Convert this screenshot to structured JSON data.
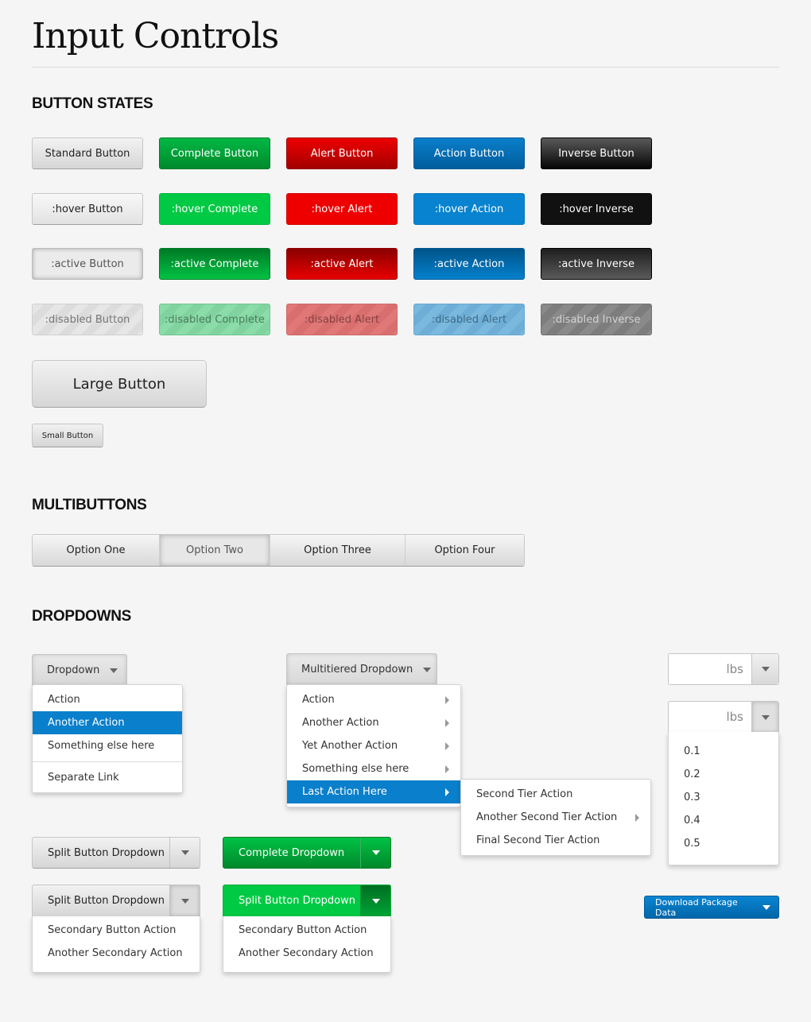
{
  "page": {
    "title": "Input Controls"
  },
  "sections": {
    "button_states": "BUTTON STATES",
    "multibuttons": "MULTIBUTTONS",
    "dropdowns": "DROPDOWNS"
  },
  "button_grid": {
    "rows": [
      {
        "state": "normal",
        "labels": [
          "Standard Button",
          "Complete Button",
          "Alert Button",
          "Action Button",
          "Inverse Button"
        ]
      },
      {
        "state": "hover",
        "labels": [
          ":hover Button",
          ":hover Complete",
          ":hover Alert",
          ":hover Action",
          ":hover Inverse"
        ]
      },
      {
        "state": "active",
        "labels": [
          ":active Button",
          ":active Complete",
          ":active Alert",
          ":active Action",
          ":active Inverse"
        ]
      },
      {
        "state": "disabled",
        "labels": [
          ":disabled Button",
          ":disabled Complete",
          ":disabled Alert",
          ":disabled Alert",
          ":disabled Inverse"
        ]
      }
    ],
    "variants": [
      "standard",
      "complete",
      "alert",
      "action",
      "inverse"
    ]
  },
  "sizes": {
    "large": "Large Button",
    "small": "Small Button"
  },
  "multibuttons": {
    "options": [
      "Option One",
      "Option Two",
      "Option Three",
      "Option Four"
    ],
    "selected": "Option Two"
  },
  "dropdown_simple": {
    "toggle": "Dropdown",
    "items": [
      "Action",
      "Another Action",
      "Something else here"
    ],
    "highlighted": "Another Action",
    "separated_items": [
      "Separate Link"
    ]
  },
  "dropdown_multitier": {
    "toggle": "Multitiered Dropdown",
    "items": [
      "Action",
      "Another Action",
      "Yet Another Action",
      "Something else here",
      "Last Action Here"
    ],
    "highlighted": "Last Action Here",
    "submenu": {
      "items": [
        "Second Tier Action",
        "Another Second Tier Action",
        "Final Second Tier Action"
      ],
      "items_with_submenu": [
        "Another Second Tier Action"
      ]
    }
  },
  "unit_inputs": [
    {
      "value": "",
      "unit": "lbs",
      "open": false
    },
    {
      "value": "",
      "unit": "lbs",
      "open": true,
      "options": [
        "0.1",
        "0.2",
        "0.3",
        "0.4",
        "0.5"
      ]
    }
  ],
  "split_buttons": [
    {
      "label": "Split Button Dropdown",
      "variant": "standard",
      "open": false
    },
    {
      "label": "Complete Dropdown",
      "variant": "complete",
      "open": false
    },
    {
      "label": "Split Button Dropdown",
      "variant": "standard",
      "open": true,
      "items": [
        "Secondary Button Action",
        "Another Secondary Action"
      ]
    },
    {
      "label": "Split Button Dropdown",
      "variant": "complete",
      "open": true,
      "items": [
        "Secondary Button Action",
        "Another Secondary Action"
      ]
    }
  ],
  "download_button": {
    "label": "Download Package Data"
  },
  "colors": {
    "background": "#f5f5f5",
    "complete": "#00b844",
    "alert": "#ee0000",
    "action": "#0a7fcb",
    "inverse": "#111111",
    "highlight": "#0a7fcb"
  }
}
